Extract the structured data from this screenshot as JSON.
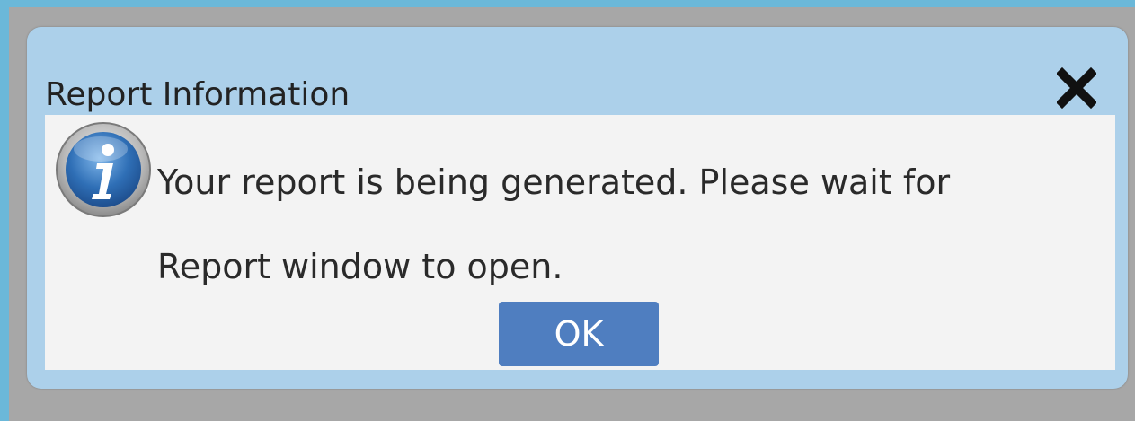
{
  "dialog": {
    "title": "Report Information",
    "message_line1": "Your report is being generated. Please wait for",
    "message_line2": "Report window to open.",
    "ok_label": "OK",
    "icon": "info-icon",
    "close_icon": "close-icon"
  },
  "colors": {
    "titlebar": "#acd0ea",
    "body": "#f3f3f3",
    "ok_button": "#4f7ec0",
    "backdrop": "#a7a7a7",
    "screen_edge": "#6bb8d9"
  }
}
